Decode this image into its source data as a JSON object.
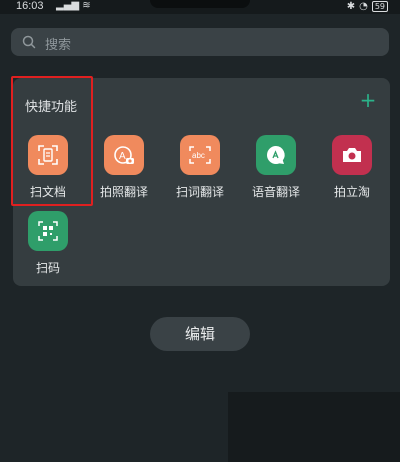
{
  "status": {
    "time": "16:03",
    "signal": "5G ",
    "battery": "59"
  },
  "search": {
    "placeholder": "搜索"
  },
  "panel": {
    "title": "快捷功能",
    "add_label": "+"
  },
  "items": [
    {
      "label": "扫文档",
      "icon": "scan-document-icon",
      "color": "#f08a5d"
    },
    {
      "label": "拍照翻译",
      "icon": "photo-translate-icon",
      "color": "#f08a5d"
    },
    {
      "label": "扫词翻译",
      "icon": "scan-word-translate-icon",
      "color": "#f08a5d"
    },
    {
      "label": "语音翻译",
      "icon": "voice-translate-icon",
      "color": "#2f9e6a"
    },
    {
      "label": "拍立淘",
      "icon": "pailitao-camera-icon",
      "color": "#c2304f"
    },
    {
      "label": "扫码",
      "icon": "qr-scan-icon",
      "color": "#2f9e6a"
    }
  ],
  "edit_button": {
    "label": "编辑"
  },
  "colors": {
    "background": "#1e2528",
    "panel": "#353d40",
    "accent": "#2bb38a",
    "highlight": "#e02020"
  }
}
